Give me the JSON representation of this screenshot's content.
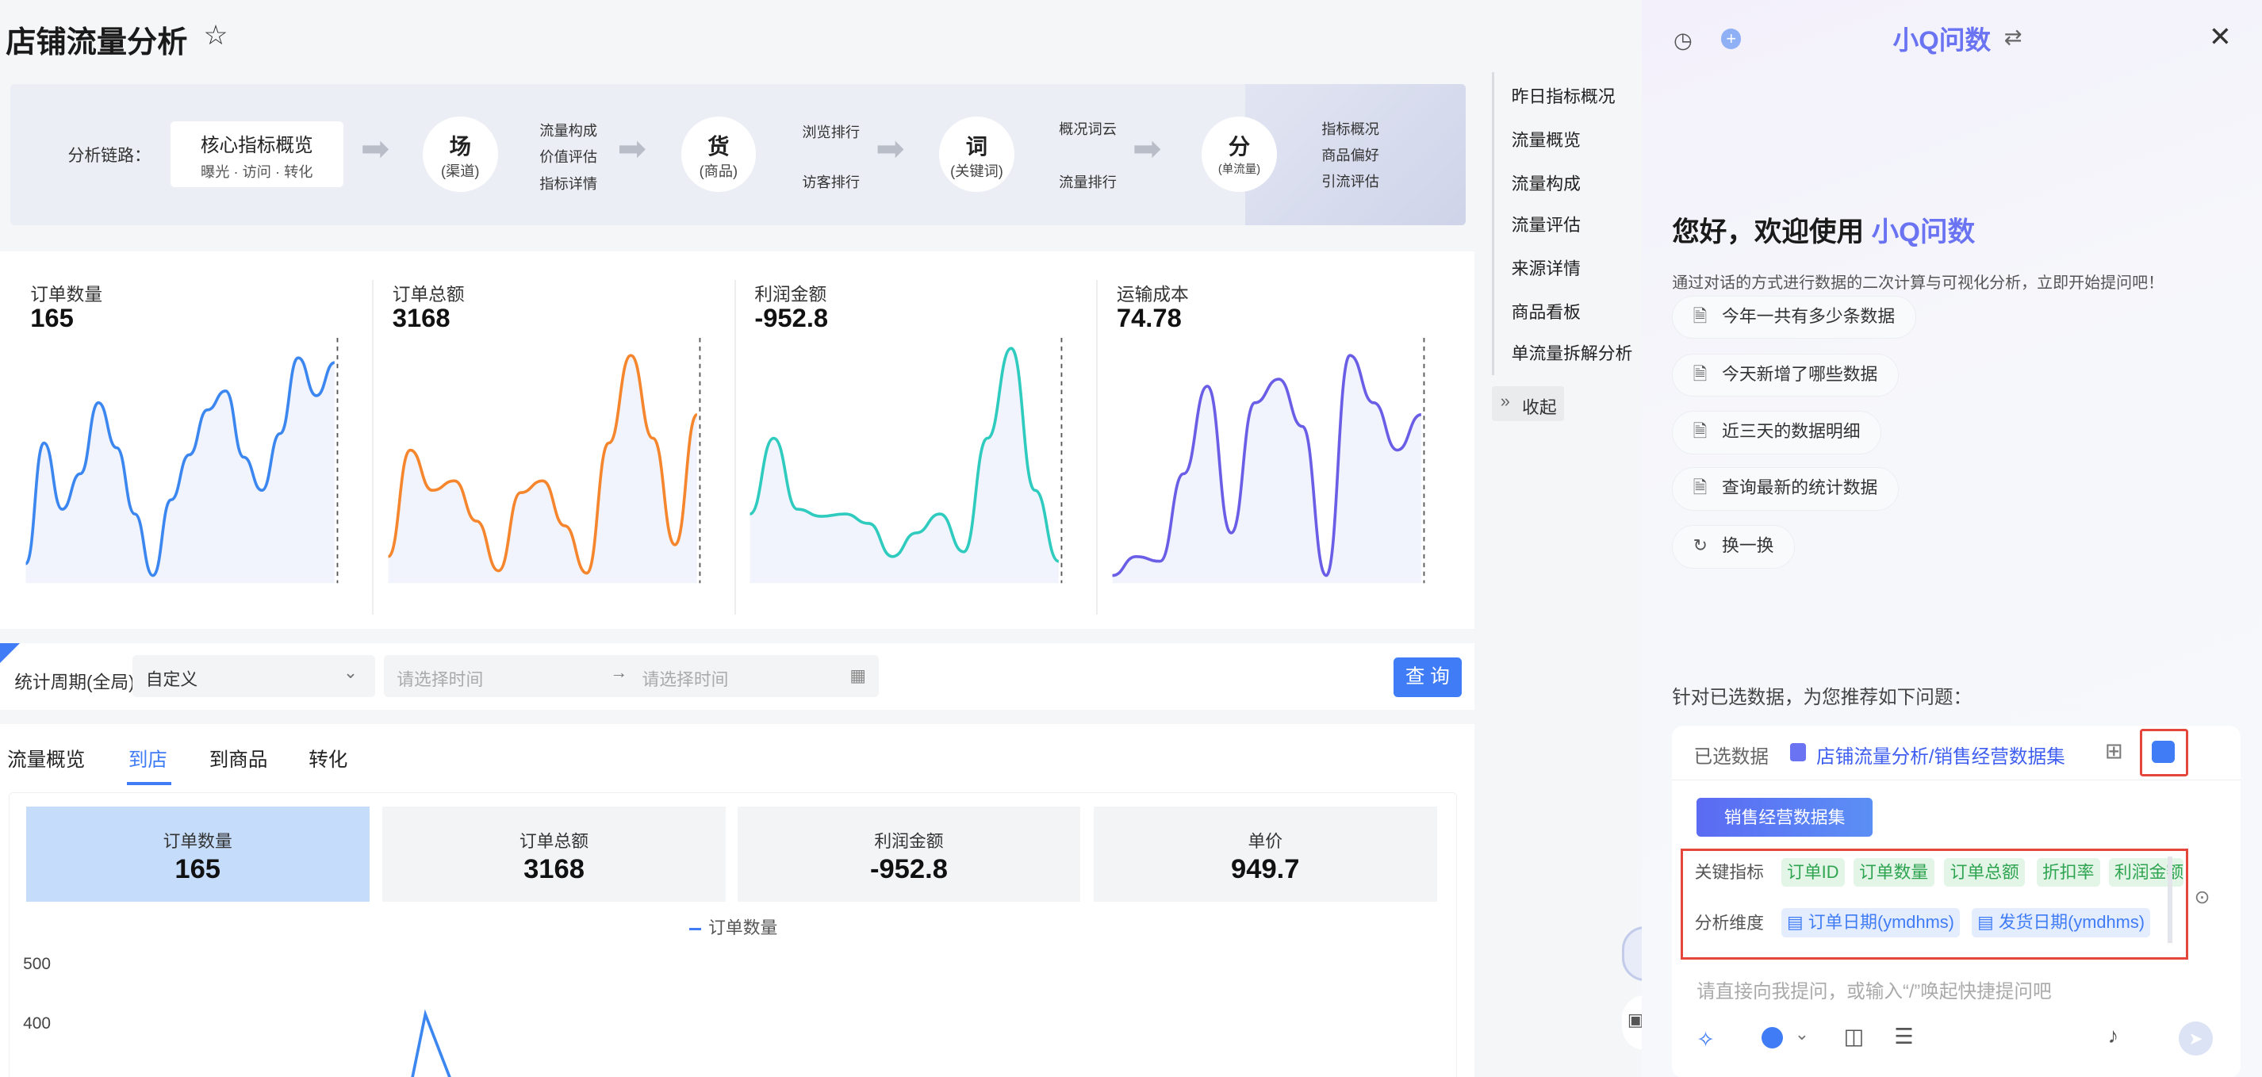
{
  "page": {
    "title": "店铺流量分析"
  },
  "chain": {
    "label": "分析链路：",
    "core_title": "核心指标概览",
    "core_sub": "曝光 · 访问 · 转化",
    "nodes": [
      {
        "big": "场",
        "small": "(渠道)",
        "branches": [
          "流量构成",
          "价值评估",
          "指标详情"
        ]
      },
      {
        "big": "货",
        "small": "(商品)",
        "branches": [
          "浏览排行",
          "访客排行"
        ]
      },
      {
        "big": "词",
        "small": "(关键词)",
        "branches": [
          "概况词云",
          "流量排行"
        ]
      },
      {
        "big": "分",
        "small": "(单流量)",
        "branches": [
          "指标概况",
          "商品偏好",
          "引流评估"
        ]
      }
    ]
  },
  "kpis": [
    {
      "name": "订单数量",
      "value": "165",
      "color": "#3b87ef",
      "series": [
        0.93,
        0.42,
        0.7,
        0.55,
        0.25,
        0.44,
        0.72,
        0.98,
        0.66,
        0.47,
        0.28,
        0.2,
        0.48,
        0.62,
        0.38,
        0.06,
        0.22,
        0.08
      ]
    },
    {
      "name": "订单总额",
      "value": "3168",
      "color": "#f5862e",
      "series": [
        0.9,
        0.45,
        0.62,
        0.58,
        0.75,
        0.96,
        0.63,
        0.58,
        0.77,
        0.97,
        0.42,
        0.05,
        0.4,
        0.85,
        0.3
      ]
    },
    {
      "name": "利润金额",
      "value": "-952.8",
      "color": "#2fcbbf",
      "series": [
        0.72,
        0.4,
        0.7,
        0.73,
        0.72,
        0.76,
        0.9,
        0.8,
        0.72,
        0.88,
        0.4,
        0.02,
        0.62,
        0.92
      ]
    },
    {
      "name": "运输成本",
      "value": "74.78",
      "color": "#6b5ee6",
      "series": [
        0.98,
        0.9,
        0.92,
        0.55,
        0.18,
        0.8,
        0.25,
        0.15,
        0.35,
        0.98,
        0.05,
        0.25,
        0.45,
        0.3
      ]
    }
  ],
  "filter": {
    "label": "统计周期(全局)",
    "select": "自定义",
    "start_placeholder": "请选择时间",
    "end_placeholder": "请选择时间",
    "query": "查 询"
  },
  "tabs": [
    "流量概览",
    "到店",
    "到商品",
    "转化"
  ],
  "cards": [
    {
      "name": "订单数量",
      "value": "165"
    },
    {
      "name": "订单总额",
      "value": "3168"
    },
    {
      "name": "利润金额",
      "value": "-952.8"
    },
    {
      "name": "单价",
      "value": "949.7"
    }
  ],
  "chart_data": {
    "type": "line",
    "series": [
      {
        "name": "订单数量",
        "values": []
      }
    ],
    "y_ticks": [
      "500",
      "400"
    ]
  },
  "nav": [
    "昨日指标概况",
    "流量概览",
    "流量构成",
    "流量评估",
    "来源详情",
    "商品看板",
    "单流量拆解分析"
  ],
  "collapse": "收起",
  "panel": {
    "logo": "小Q问数",
    "welcome": "您好，欢迎使用",
    "welcome_brand": "小Q问数",
    "subtitle": "通过对话的方式进行数据的二次计算与可视化分析，立即开始提问吧！",
    "suggestions": [
      "今年一共有多少条数据",
      "今天新增了哪些数据",
      "近三天的数据明细",
      "查询最新的统计数据"
    ],
    "refresh": "换一换",
    "recommend": "针对已选数据，为您推荐如下问题：",
    "selected_label": "已选数据",
    "selected_value": "店铺流量分析/销售经营数据集",
    "dataset_pill": "销售经营数据集",
    "metrics_label": "关键指标",
    "metrics": [
      "订单ID",
      "订单数量",
      "订单总额",
      "折扣率",
      "利润金额"
    ],
    "dims_label": "分析维度",
    "dims": [
      "订单日期(ymdhms)",
      "发货日期(ymdhms)"
    ],
    "input_placeholder": "请直接向我提问，或输入“/”唤起快捷提问吧"
  }
}
